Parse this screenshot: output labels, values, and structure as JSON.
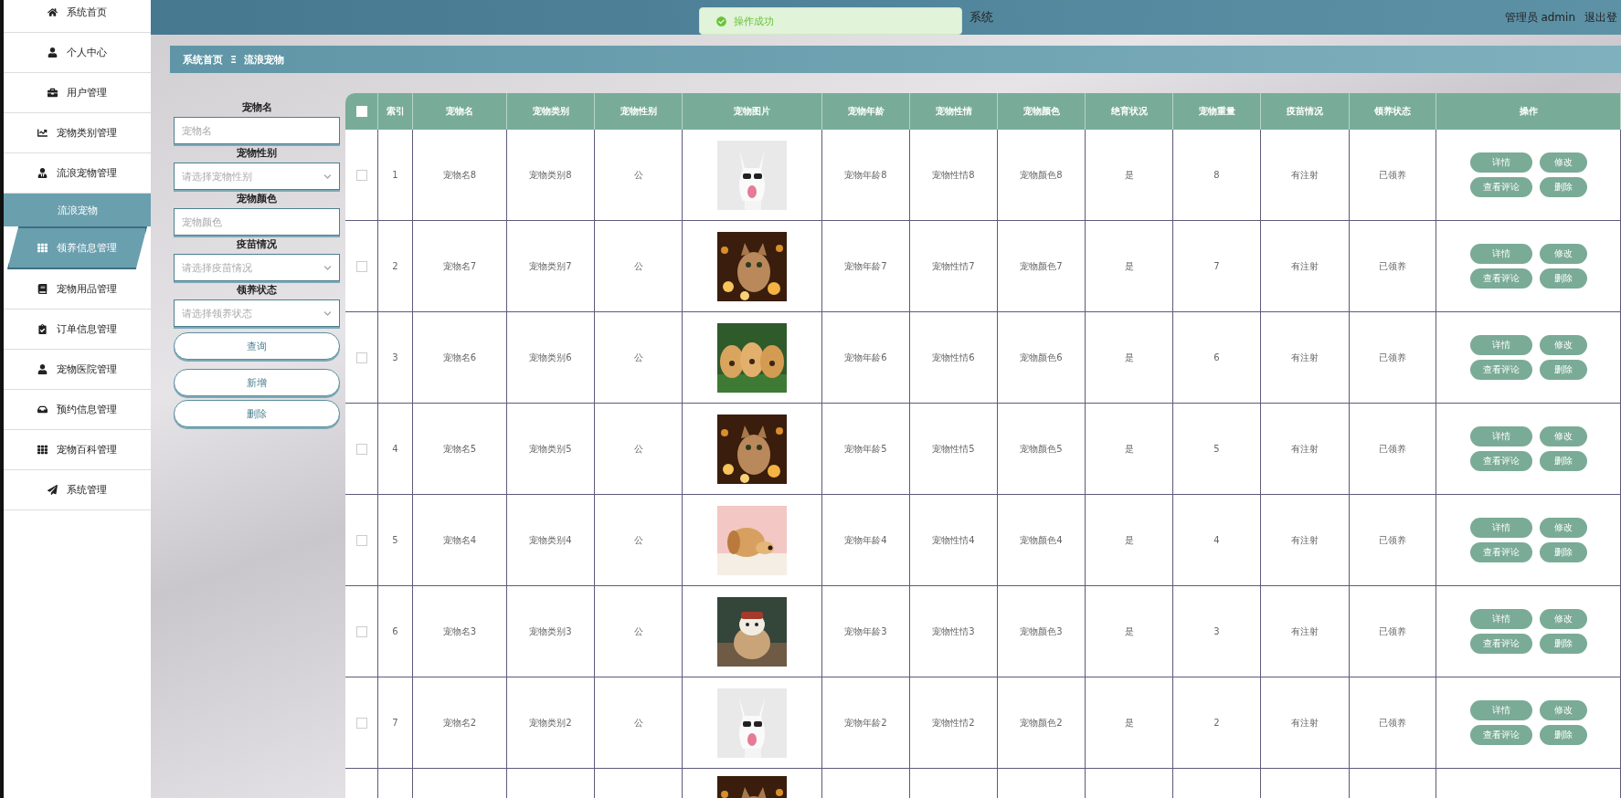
{
  "header": {
    "title": "系统",
    "user": "管理员 admin",
    "logout": "退出登"
  },
  "toast": {
    "text": "操作成功"
  },
  "sidebar": {
    "items": [
      {
        "label": "系统首页",
        "hovered": false
      },
      {
        "label": "个人中心",
        "hovered": false
      },
      {
        "label": "用户管理",
        "hovered": false
      },
      {
        "label": "宠物类别管理",
        "hovered": false
      },
      {
        "label": "流浪宠物管理",
        "hovered": false,
        "children": [
          {
            "label": "流浪宠物",
            "selected": true
          }
        ]
      },
      {
        "label": "领养信息管理",
        "hovered": true
      },
      {
        "label": "宠物用品管理",
        "hovered": false
      },
      {
        "label": "订单信息管理",
        "hovered": false
      },
      {
        "label": "宠物医院管理",
        "hovered": false
      },
      {
        "label": "预约信息管理",
        "hovered": false
      },
      {
        "label": "宠物百科管理",
        "hovered": false
      },
      {
        "label": "系统管理",
        "hovered": false
      }
    ]
  },
  "breadcrumb": [
    "系统首页",
    "流浪宠物"
  ],
  "breadcrumb_separator": "Ξ",
  "filters": [
    {
      "kind": "input",
      "label": "宠物名",
      "placeholder": "宠物名"
    },
    {
      "kind": "select",
      "label": "宠物性别",
      "placeholder": "请选择宠物性别"
    },
    {
      "kind": "input",
      "label": "宠物颜色",
      "placeholder": "宠物颜色"
    },
    {
      "kind": "select",
      "label": "疫苗情况",
      "placeholder": "请选择疫苗情况"
    },
    {
      "kind": "select",
      "label": "领养状态",
      "placeholder": "请选择领养状态"
    }
  ],
  "filter_buttons": [
    "查询",
    "新增",
    "删除"
  ],
  "table": {
    "all_selected": false,
    "columns": [
      "索引",
      "宠物名",
      "宠物类别",
      "宠物性别",
      "宠物图片",
      "宠物年龄",
      "宠物性情",
      "宠物颜色",
      "绝育状况",
      "宠物重量",
      "疫苗情况",
      "领养状态",
      "操作"
    ],
    "rows": [
      {
        "selected": false,
        "cells": [
          "1",
          "宠物名8",
          "宠物类别8",
          "公",
          null,
          "宠物年龄8",
          "宠物性情8",
          "宠物颜色8",
          "是",
          "8",
          "有注射",
          "已领养"
        ],
        "actions": [
          "详情",
          "修改",
          "查看评论",
          "删除"
        ]
      },
      {
        "selected": false,
        "cells": [
          "2",
          "宠物名7",
          "宠物类别7",
          "公",
          null,
          "宠物年龄7",
          "宠物性情7",
          "宠物颜色7",
          "是",
          "7",
          "有注射",
          "已领养"
        ],
        "actions": [
          "详情",
          "修改",
          "查看评论",
          "删除"
        ]
      },
      {
        "selected": false,
        "cells": [
          "3",
          "宠物名6",
          "宠物类别6",
          "公",
          null,
          "宠物年龄6",
          "宠物性情6",
          "宠物颜色6",
          "是",
          "6",
          "有注射",
          "已领养"
        ],
        "actions": [
          "详情",
          "修改",
          "查看评论",
          "删除"
        ]
      },
      {
        "selected": false,
        "cells": [
          "4",
          "宠物名5",
          "宠物类别5",
          "公",
          null,
          "宠物年龄5",
          "宠物性情5",
          "宠物颜色5",
          "是",
          "5",
          "有注射",
          "已领养"
        ],
        "actions": [
          "详情",
          "修改",
          "查看评论",
          "删除"
        ]
      },
      {
        "selected": false,
        "cells": [
          "5",
          "宠物名4",
          "宠物类别4",
          "公",
          null,
          "宠物年龄4",
          "宠物性情4",
          "宠物颜色4",
          "是",
          "4",
          "有注射",
          "已领养"
        ],
        "actions": [
          "详情",
          "修改",
          "查看评论",
          "删除"
        ]
      },
      {
        "selected": false,
        "cells": [
          "6",
          "宠物名3",
          "宠物类别3",
          "公",
          null,
          "宠物年龄3",
          "宠物性情3",
          "宠物颜色3",
          "是",
          "3",
          "有注射",
          "已领养"
        ],
        "actions": [
          "详情",
          "修改",
          "查看评论",
          "删除"
        ]
      },
      {
        "selected": false,
        "cells": [
          "7",
          "宠物名2",
          "宠物类别2",
          "公",
          null,
          "宠物年龄2",
          "宠物性情2",
          "宠物颜色2",
          "是",
          "2",
          "有注射",
          "已领养"
        ],
        "actions": [
          "详情",
          "修改",
          "查看评论",
          "删除"
        ]
      },
      {
        "kind": "picture"
      }
    ]
  }
}
